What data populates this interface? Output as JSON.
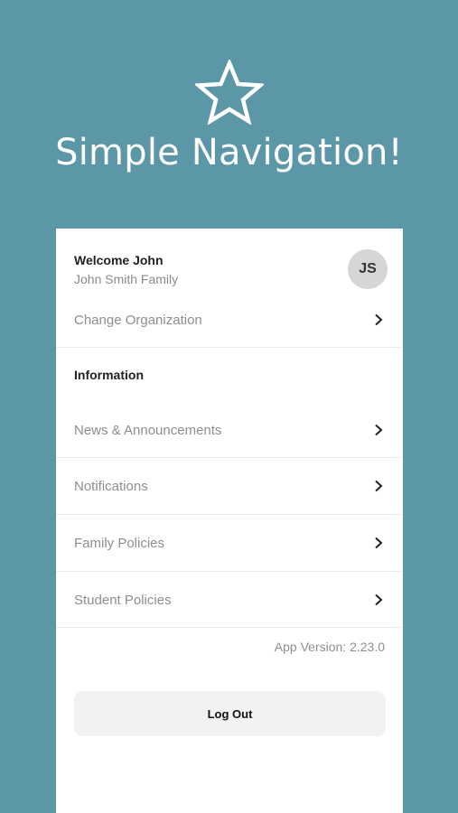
{
  "hero": {
    "icon": "star-outline-icon",
    "title": "Simple Navigation!"
  },
  "colors": {
    "background": "#5b97a7",
    "panel": "#ffffff",
    "avatar": "#d6d6d6",
    "logout_button": "#f2f2f4"
  },
  "account": {
    "welcome": "Welcome John",
    "family": "John Smith Family",
    "avatar_initials": "JS"
  },
  "menu": {
    "change_org": "Change Organization",
    "section_title": "Information",
    "items": [
      {
        "label": "News & Announcements",
        "icon": "chevron-right-icon"
      },
      {
        "label": "Notifications",
        "icon": "chevron-right-icon"
      },
      {
        "label": "Family Policies",
        "icon": "chevron-right-icon"
      },
      {
        "label": "Student Policies",
        "icon": "chevron-right-icon"
      }
    ]
  },
  "footer": {
    "app_version": "App Version: 2.23.0",
    "logout_label": "Log Out"
  }
}
